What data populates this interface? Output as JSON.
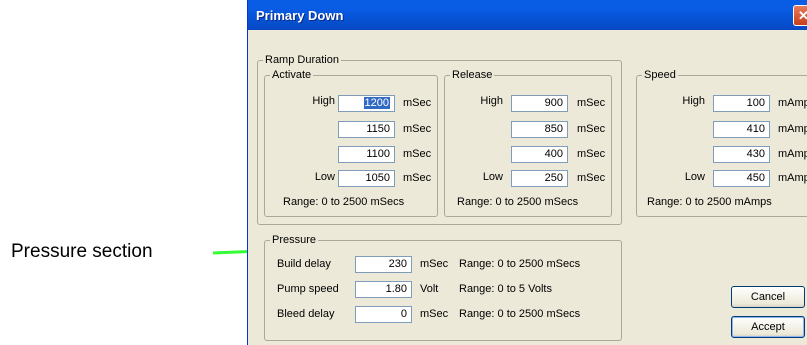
{
  "annotation": {
    "label": "Pressure section",
    "arrow_color": "#33ff33"
  },
  "window": {
    "title": "Primary Down",
    "close_glyph": "✕"
  },
  "ramp_duration": {
    "legend": "Ramp Duration",
    "activate": {
      "legend": "Activate",
      "labels": [
        "High",
        "",
        "",
        "Low"
      ],
      "values": [
        "1200",
        "1150",
        "1100",
        "1050"
      ],
      "unit": "mSec",
      "range": "Range: 0 to 2500 mSecs"
    },
    "release": {
      "legend": "Release",
      "labels": [
        "High",
        "",
        "",
        "Low"
      ],
      "values": [
        "900",
        "850",
        "400",
        "250"
      ],
      "unit": "mSec",
      "range": "Range: 0 to 2500 mSecs"
    }
  },
  "speed": {
    "legend": "Speed",
    "labels": [
      "High",
      "",
      "",
      "Low"
    ],
    "values": [
      "100",
      "410",
      "430",
      "450"
    ],
    "unit": "mAmp",
    "range": "Range: 0 to 2500 mAmps"
  },
  "pressure": {
    "legend": "Pressure",
    "rows": [
      {
        "label": "Build delay",
        "value": "230",
        "unit": "mSec",
        "range": "Range: 0 to 2500 mSecs"
      },
      {
        "label": "Pump speed",
        "value": "1.80",
        "unit": "Volt",
        "range": "Range: 0 to 5 Volts"
      },
      {
        "label": "Bleed delay",
        "value": "0",
        "unit": "mSec",
        "range": "Range: 0 to 2500 mSecs"
      }
    ]
  },
  "buttons": {
    "cancel": "Cancel",
    "accept": "Accept"
  }
}
